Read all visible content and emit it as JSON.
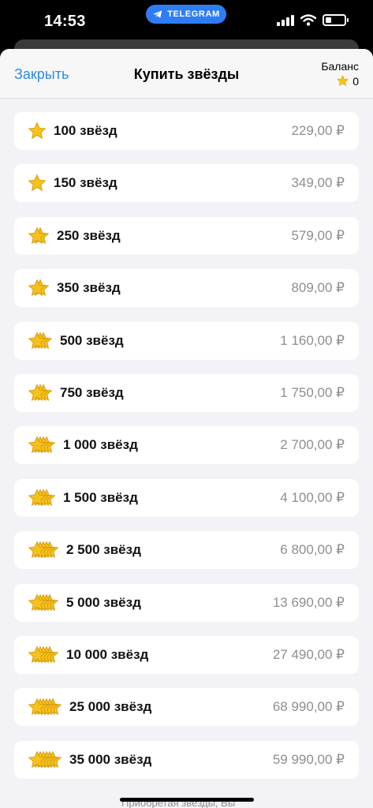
{
  "status_bar": {
    "time": "14:53",
    "pill_label": "TELEGRAM",
    "pill_color": "#2f7df6",
    "icons": [
      "cellular-signal-icon",
      "wifi-icon",
      "battery-icon"
    ]
  },
  "header": {
    "close_label": "Закрыть",
    "title": "Купить звёзды",
    "balance_label": "Баланс",
    "balance_value": "0",
    "link_color": "#2b8ae6"
  },
  "star_color": "#f5c21b",
  "packages": [
    {
      "label": "100 звёзд",
      "price": "229,00 ₽",
      "stars": 1
    },
    {
      "label": "150 звёзд",
      "price": "349,00 ₽",
      "stars": 1
    },
    {
      "label": "250 звёзд",
      "price": "579,00 ₽",
      "stars": 2
    },
    {
      "label": "350 звёзд",
      "price": "809,00 ₽",
      "stars": 2
    },
    {
      "label": "500 звёзд",
      "price": "1 160,00 ₽",
      "stars": 3
    },
    {
      "label": "750 звёзд",
      "price": "1 750,00 ₽",
      "stars": 3
    },
    {
      "label": "1 000 звёзд",
      "price": "2 700,00 ₽",
      "stars": 4
    },
    {
      "label": "1 500 звёзд",
      "price": "4 100,00 ₽",
      "stars": 4
    },
    {
      "label": "2 500 звёзд",
      "price": "6 800,00 ₽",
      "stars": 5
    },
    {
      "label": "5 000 звёзд",
      "price": "13 690,00 ₽",
      "stars": 5
    },
    {
      "label": "10 000 звёзд",
      "price": "27 490,00 ₽",
      "stars": 5
    },
    {
      "label": "25 000 звёзд",
      "price": "68 990,00 ₽",
      "stars": 6
    },
    {
      "label": "35 000 звёзд",
      "price": "59 990,00 ₽",
      "stars": 6
    }
  ],
  "footer_text": "Приобретая звёзды, Вы"
}
